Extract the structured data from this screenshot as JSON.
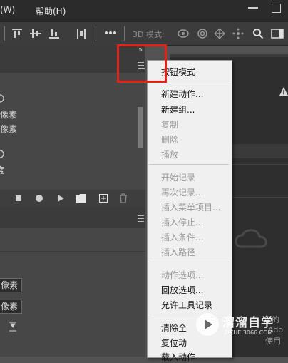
{
  "menubar": {
    "items": [
      "(W)",
      "帮助(H)"
    ]
  },
  "options_bar": {
    "mode_label": "3D 模式:"
  },
  "left_panel": {
    "layer_props": [
      "像素",
      "像素",
      "度"
    ],
    "input_fields": [
      "像素",
      "像素"
    ]
  },
  "context_menu": {
    "items": [
      {
        "label": "按钮模式",
        "enabled": true
      },
      {
        "label": "新建动作...",
        "enabled": true
      },
      {
        "label": "新建组...",
        "enabled": true
      },
      {
        "label": "复制",
        "enabled": false
      },
      {
        "label": "删除",
        "enabled": false
      },
      {
        "label": "播放",
        "enabled": false
      },
      {
        "label": "开始记录",
        "enabled": false
      },
      {
        "label": "再次记录...",
        "enabled": false
      },
      {
        "label": "插入菜单项目...",
        "enabled": false
      },
      {
        "label": "插入停止...",
        "enabled": false
      },
      {
        "label": "插入条件...",
        "enabled": false
      },
      {
        "label": "插入路径",
        "enabled": false
      },
      {
        "label": "动作选项...",
        "enabled": false
      },
      {
        "label": "回放选项...",
        "enabled": true
      },
      {
        "label": "允许工具记录",
        "enabled": true
      },
      {
        "label": "清除全",
        "enabled": true
      },
      {
        "label": "复位动",
        "enabled": true
      },
      {
        "label": "载入动作",
        "enabled": true
      }
    ]
  },
  "right_panel": {
    "notice_lines": [
      "您的",
      "Ado",
      "使用"
    ]
  },
  "watermark": {
    "title": "溜溜自学",
    "url": "ZIXUE.3066.COM"
  },
  "colors": {
    "highlight": "#e2231a",
    "menu_bg": "#f0f0f0"
  }
}
